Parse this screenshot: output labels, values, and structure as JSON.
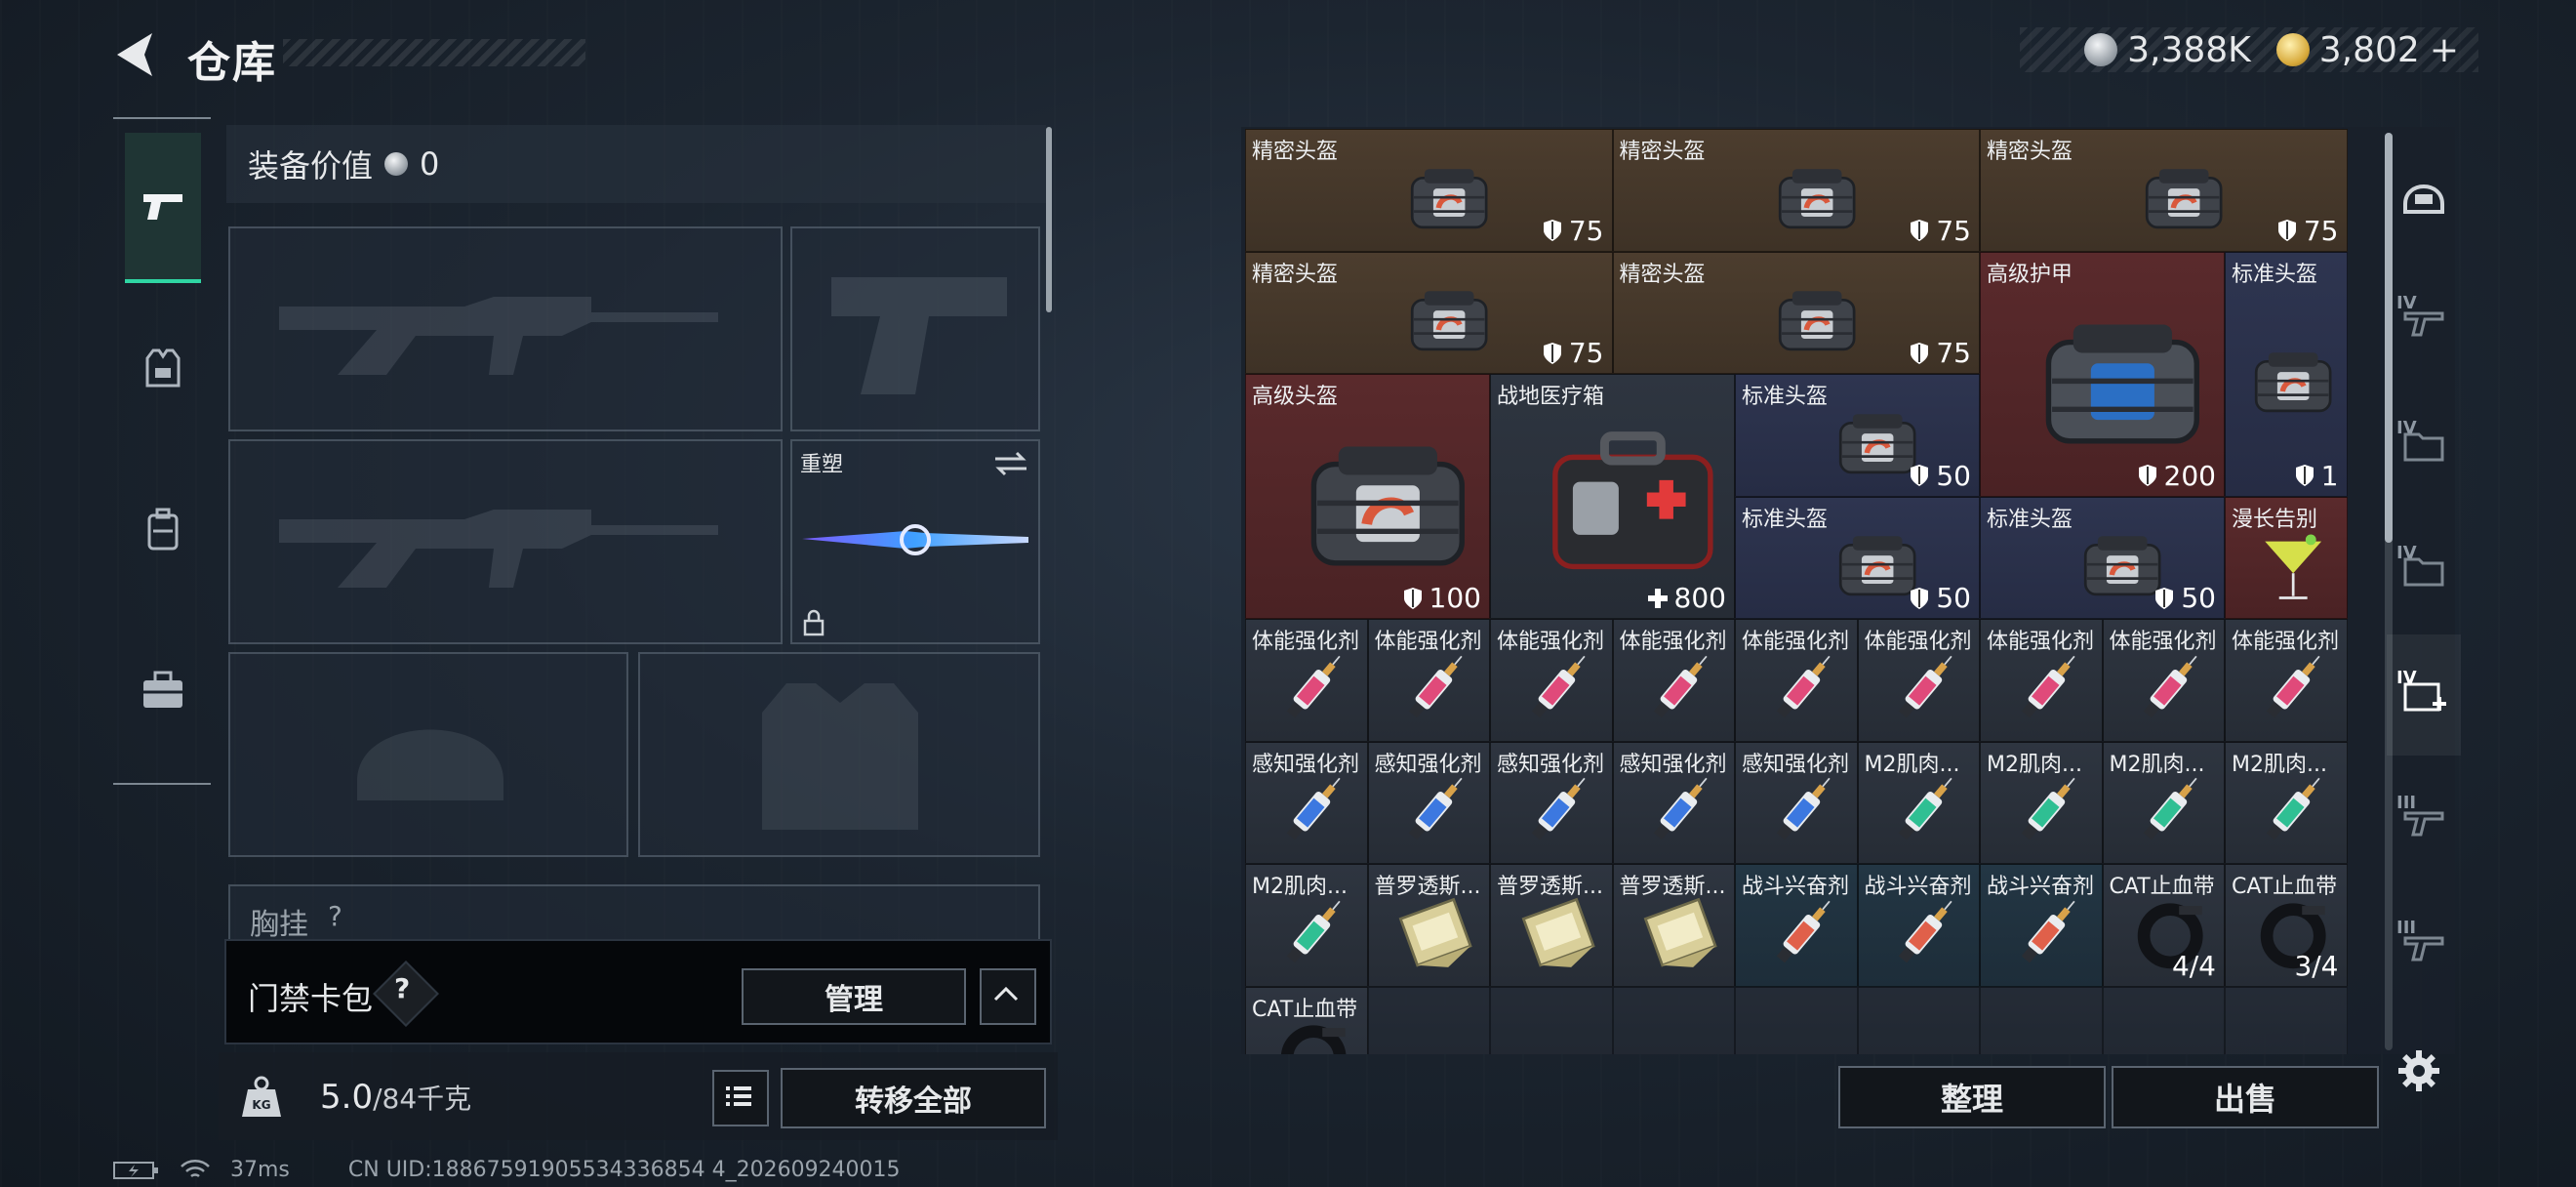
{
  "header": {
    "title": "仓库"
  },
  "currencies": [
    {
      "name": "silver-coin",
      "amount": "3,388K"
    },
    {
      "name": "gold-coin",
      "amount": "3,802",
      "add": "+"
    }
  ],
  "left_tabs": [
    "weapons-tab",
    "gear-tab",
    "backpack-tab",
    "supplies-tab"
  ],
  "loadout": {
    "value_label": "装备价值",
    "value": "0",
    "skin_name": "重塑",
    "next_row_label": "胸挂",
    "next_row_value": "?"
  },
  "keycard": {
    "label": "门禁卡包",
    "help": "?",
    "manage": "管理"
  },
  "weight": {
    "current": "5.0",
    "capacity": "/84",
    "unit": "千克",
    "transfer_all": "转移全部"
  },
  "status": {
    "ping": "37ms",
    "uid": "CN UID:18867591905534336854 4_202609240015"
  },
  "stash": {
    "sort_label": "整理",
    "sell_label": "出售",
    "items": [
      {
        "name": "精密头盔",
        "value": "75",
        "value_icon": "shield",
        "color": "brown",
        "icon": "helmet",
        "col": 0,
        "row": 0,
        "w": 3,
        "h": 1
      },
      {
        "name": "精密头盔",
        "value": "75",
        "value_icon": "shield",
        "color": "brown",
        "icon": "helmet",
        "col": 3,
        "row": 0,
        "w": 3,
        "h": 1
      },
      {
        "name": "精密头盔",
        "value": "75",
        "value_icon": "shield",
        "color": "brown",
        "icon": "helmet",
        "col": 6,
        "row": 0,
        "w": 3,
        "h": 1
      },
      {
        "name": "精密头盔",
        "value": "75",
        "value_icon": "shield",
        "color": "brown",
        "icon": "helmet",
        "col": 0,
        "row": 1,
        "w": 3,
        "h": 1
      },
      {
        "name": "精密头盔",
        "value": "75",
        "value_icon": "shield",
        "color": "brown",
        "icon": "helmet",
        "col": 3,
        "row": 1,
        "w": 3,
        "h": 1
      },
      {
        "name": "高级护甲",
        "value": "200",
        "value_icon": "shield",
        "color": "red",
        "icon": "armor",
        "col": 6,
        "row": 1,
        "w": 2,
        "h": 2
      },
      {
        "name": "标准头盔",
        "value": "1",
        "value_icon": "shield",
        "color": "blue",
        "icon": "helmet-small",
        "col": 8,
        "row": 1,
        "w": 1,
        "h": 2
      },
      {
        "name": "高级头盔",
        "value": "100",
        "value_icon": "shield",
        "color": "red",
        "icon": "helmet-big",
        "col": 0,
        "row": 2,
        "w": 2,
        "h": 2
      },
      {
        "name": "战地医疗箱",
        "value": "800",
        "value_icon": "plus",
        "color": "gray",
        "icon": "medkit",
        "col": 2,
        "row": 2,
        "w": 2,
        "h": 2
      },
      {
        "name": "标准头盔",
        "value": "50",
        "value_icon": "shield",
        "color": "blue",
        "icon": "helmet",
        "col": 4,
        "row": 2,
        "w": 2,
        "h": 1
      },
      {
        "name": "标准头盔",
        "value": "50",
        "value_icon": "shield",
        "color": "blue",
        "icon": "helmet",
        "col": 4,
        "row": 3,
        "w": 2,
        "h": 1
      },
      {
        "name": "标准头盔",
        "value": "50",
        "value_icon": "shield",
        "color": "blue",
        "icon": "helmet",
        "col": 6,
        "row": 3,
        "w": 2,
        "h": 1
      },
      {
        "name": "漫长告别",
        "value": "",
        "value_icon": "",
        "color": "red",
        "icon": "cocktail",
        "col": 8,
        "row": 3,
        "w": 1,
        "h": 1
      },
      {
        "name": "体能强化剂",
        "value": "",
        "value_icon": "",
        "color": "gray",
        "icon": "syringe-red",
        "col": 0,
        "row": 4,
        "w": 1,
        "h": 1
      },
      {
        "name": "体能强化剂",
        "value": "",
        "value_icon": "",
        "color": "gray",
        "icon": "syringe-red",
        "col": 1,
        "row": 4,
        "w": 1,
        "h": 1
      },
      {
        "name": "体能强化剂",
        "value": "",
        "value_icon": "",
        "color": "gray",
        "icon": "syringe-red",
        "col": 2,
        "row": 4,
        "w": 1,
        "h": 1
      },
      {
        "name": "体能强化剂",
        "value": "",
        "value_icon": "",
        "color": "gray",
        "icon": "syringe-red",
        "col": 3,
        "row": 4,
        "w": 1,
        "h": 1
      },
      {
        "name": "体能强化剂",
        "value": "",
        "value_icon": "",
        "color": "gray",
        "icon": "syringe-red",
        "col": 4,
        "row": 4,
        "w": 1,
        "h": 1
      },
      {
        "name": "体能强化剂",
        "value": "",
        "value_icon": "",
        "color": "gray",
        "icon": "syringe-red",
        "col": 5,
        "row": 4,
        "w": 1,
        "h": 1
      },
      {
        "name": "体能强化剂",
        "value": "",
        "value_icon": "",
        "color": "gray",
        "icon": "syringe-red",
        "col": 6,
        "row": 4,
        "w": 1,
        "h": 1
      },
      {
        "name": "体能强化剂",
        "value": "",
        "value_icon": "",
        "color": "gray",
        "icon": "syringe-red",
        "col": 7,
        "row": 4,
        "w": 1,
        "h": 1
      },
      {
        "name": "体能强化剂",
        "value": "",
        "value_icon": "",
        "color": "gray",
        "icon": "syringe-red",
        "col": 8,
        "row": 4,
        "w": 1,
        "h": 1
      },
      {
        "name": "感知强化剂",
        "value": "",
        "value_icon": "",
        "color": "gray",
        "icon": "syringe-blue",
        "col": 0,
        "row": 5,
        "w": 1,
        "h": 1
      },
      {
        "name": "感知强化剂",
        "value": "",
        "value_icon": "",
        "color": "gray",
        "icon": "syringe-blue",
        "col": 1,
        "row": 5,
        "w": 1,
        "h": 1
      },
      {
        "name": "感知强化剂",
        "value": "",
        "value_icon": "",
        "color": "gray",
        "icon": "syringe-blue",
        "col": 2,
        "row": 5,
        "w": 1,
        "h": 1
      },
      {
        "name": "感知强化剂",
        "value": "",
        "value_icon": "",
        "color": "gray",
        "icon": "syringe-blue",
        "col": 3,
        "row": 5,
        "w": 1,
        "h": 1
      },
      {
        "name": "感知强化剂",
        "value": "",
        "value_icon": "",
        "color": "gray",
        "icon": "syringe-blue",
        "col": 4,
        "row": 5,
        "w": 1,
        "h": 1
      },
      {
        "name": "M2肌肉...",
        "value": "",
        "value_icon": "",
        "color": "gray",
        "icon": "syringe-green",
        "col": 5,
        "row": 5,
        "w": 1,
        "h": 1
      },
      {
        "name": "M2肌肉...",
        "value": "",
        "value_icon": "",
        "color": "gray",
        "icon": "syringe-green",
        "col": 6,
        "row": 5,
        "w": 1,
        "h": 1
      },
      {
        "name": "M2肌肉...",
        "value": "",
        "value_icon": "",
        "color": "gray",
        "icon": "syringe-green",
        "col": 7,
        "row": 5,
        "w": 1,
        "h": 1
      },
      {
        "name": "M2肌肉...",
        "value": "",
        "value_icon": "",
        "color": "gray",
        "icon": "syringe-green",
        "col": 8,
        "row": 5,
        "w": 1,
        "h": 1
      },
      {
        "name": "M2肌肉...",
        "value": "",
        "value_icon": "",
        "color": "gray",
        "icon": "syringe-green",
        "col": 0,
        "row": 6,
        "w": 1,
        "h": 1
      },
      {
        "name": "普罗透斯...",
        "value": "",
        "value_icon": "",
        "color": "gray",
        "icon": "pack",
        "col": 1,
        "row": 6,
        "w": 1,
        "h": 1
      },
      {
        "name": "普罗透斯...",
        "value": "",
        "value_icon": "",
        "color": "gray",
        "icon": "pack",
        "col": 2,
        "row": 6,
        "w": 1,
        "h": 1
      },
      {
        "name": "普罗透斯...",
        "value": "",
        "value_icon": "",
        "color": "gray",
        "icon": "pack",
        "col": 3,
        "row": 6,
        "w": 1,
        "h": 1
      },
      {
        "name": "战斗兴奋剂",
        "value": "",
        "value_icon": "",
        "color": "teal",
        "icon": "syringe-orange",
        "col": 4,
        "row": 6,
        "w": 1,
        "h": 1
      },
      {
        "name": "战斗兴奋剂",
        "value": "",
        "value_icon": "",
        "color": "teal",
        "icon": "syringe-orange",
        "col": 5,
        "row": 6,
        "w": 1,
        "h": 1
      },
      {
        "name": "战斗兴奋剂",
        "value": "",
        "value_icon": "",
        "color": "teal",
        "icon": "syringe-orange",
        "col": 6,
        "row": 6,
        "w": 1,
        "h": 1
      },
      {
        "name": "CAT止血带",
        "value": "4/4",
        "value_icon": "",
        "color": "gray",
        "icon": "tourniquet",
        "col": 7,
        "row": 6,
        "w": 1,
        "h": 1
      },
      {
        "name": "CAT止血带",
        "value": "3/4",
        "value_icon": "",
        "color": "gray",
        "icon": "tourniquet",
        "col": 8,
        "row": 6,
        "w": 1,
        "h": 1
      },
      {
        "name": "CAT止血带",
        "value": "",
        "value_icon": "",
        "color": "gray",
        "icon": "tourniquet",
        "col": 0,
        "row": 7,
        "w": 1,
        "h": 1
      }
    ]
  },
  "filters": [
    {
      "name": "filter-helmet",
      "level": ""
    },
    {
      "name": "filter-weapon-iv",
      "level": "IV"
    },
    {
      "name": "filter-folder-iv",
      "level": "IV"
    },
    {
      "name": "filter-folder-iv-2",
      "level": "IV"
    },
    {
      "name": "filter-medkit-iv",
      "level": "IV"
    },
    {
      "name": "filter-weapon-iii",
      "level": "III"
    },
    {
      "name": "filter-weapon-iii-2",
      "level": "III"
    }
  ],
  "colors": {
    "accent": "#2fd6a3",
    "brown": "#4c3d2e",
    "red": "#5a2a2c",
    "blue": "#2e3550",
    "gray": "#2e3540",
    "teal": "#233644"
  }
}
